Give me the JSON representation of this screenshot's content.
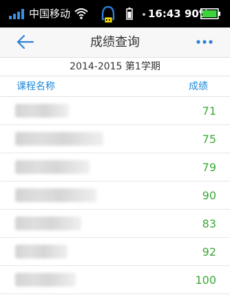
{
  "status_bar": {
    "carrier": "中国移动",
    "time": "16:43",
    "battery": "90%"
  },
  "nav": {
    "title": "成绩查询"
  },
  "term": {
    "label": "2014-2015 第1学期"
  },
  "columns": {
    "course_name": "课程名称",
    "score": "成绩"
  },
  "rows": [
    {
      "score": "71"
    },
    {
      "score": "75"
    },
    {
      "score": "79"
    },
    {
      "score": "90"
    },
    {
      "score": "83"
    },
    {
      "score": "92"
    },
    {
      "score": "100"
    }
  ],
  "colors": {
    "accent": "#1e88d8",
    "score": "#3aa935",
    "status_bar": "#000000",
    "battery": "#3cd33c"
  },
  "icons": {
    "back": "arrow-left-icon",
    "more": "more-horizontal-icon",
    "wifi": "wifi-icon",
    "signal": "signal-icon",
    "battery": "battery-icon"
  }
}
